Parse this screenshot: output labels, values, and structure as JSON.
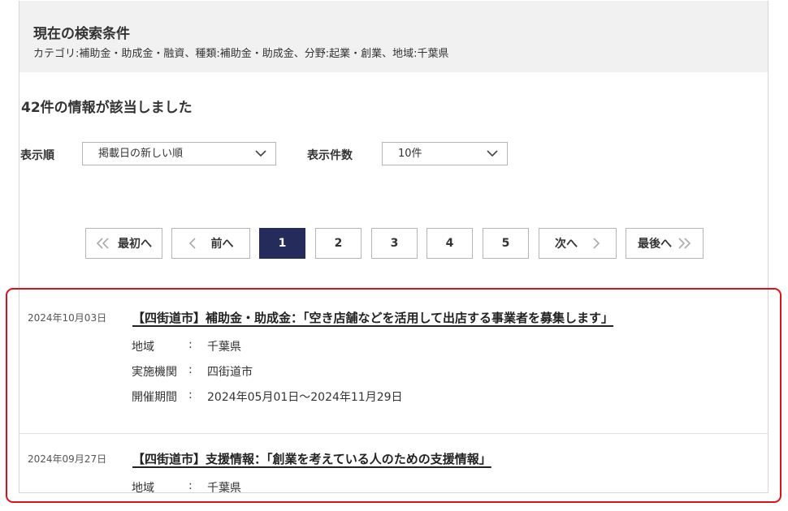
{
  "search_conditions": {
    "title": "現在の検索条件",
    "text": "カテゴリ:補助金・助成金・融資、種類:補助金・助成金、分野:起業・創業、地域:千葉県"
  },
  "result_count_text": "42件の情報が該当しました",
  "controls": {
    "sort_label": "表示順",
    "sort_value": "掲載日の新しい順",
    "count_label": "表示件数",
    "count_value": "10件"
  },
  "pagination": {
    "first": "最初へ",
    "prev": "前へ",
    "pages": [
      "1",
      "2",
      "3",
      "4",
      "5"
    ],
    "current_page": "1",
    "next": "次へ",
    "last": "最後へ"
  },
  "results": [
    {
      "date": "2024年10月03日",
      "title": "【四街道市】補助金・助成金：「空き店舗などを活用して出店する事業者を募集します」",
      "fields": [
        {
          "label": "地域",
          "colon": ":",
          "value": "千葉県"
        },
        {
          "label": "実施機関",
          "colon": ":",
          "value": "四街道市"
        },
        {
          "label": "開催期間",
          "colon": ":",
          "value": "2024年05月01日～2024年11月29日"
        }
      ]
    },
    {
      "date": "2024年09月27日",
      "title": "【四街道市】支援情報：「創業を考えている人のための支援情報」",
      "fields": [
        {
          "label": "地域",
          "colon": ":",
          "value": "千葉県"
        }
      ]
    }
  ],
  "colors": {
    "current_page_bg": "#252b5a",
    "highlight_border": "#e0101b",
    "condition_box_bg": "#f1f1f1"
  }
}
